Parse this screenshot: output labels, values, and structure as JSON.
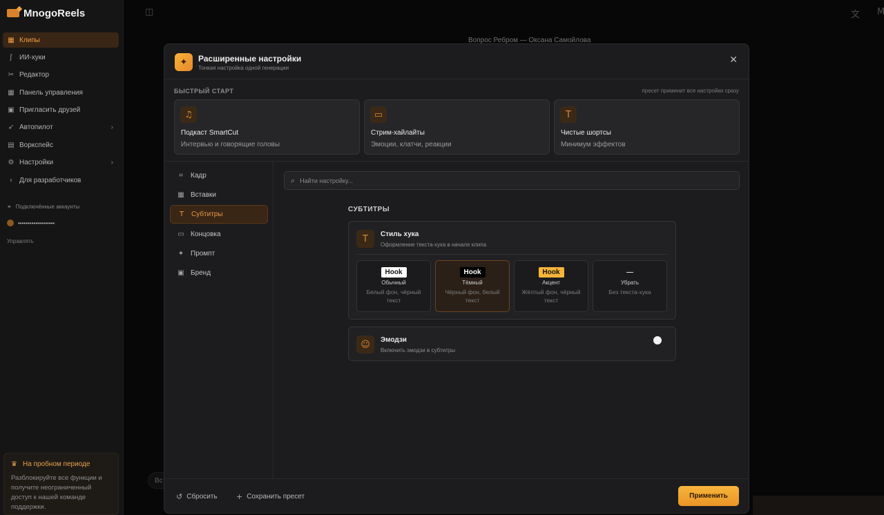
{
  "app": {
    "name": "MnogoReels"
  },
  "sidebar": {
    "items": [
      {
        "label": "Клипы",
        "icon": "clapper-icon",
        "glyph": "▦",
        "active": true
      },
      {
        "label": "ИИ-хуки",
        "icon": "hook-icon",
        "glyph": "ʃ"
      },
      {
        "label": "Редактор",
        "icon": "scissors-icon",
        "glyph": "✂"
      },
      {
        "label": "Панель управления",
        "icon": "grid-icon",
        "glyph": "▦"
      },
      {
        "label": "Пригласить друзей",
        "icon": "gift-icon",
        "glyph": "▣"
      },
      {
        "label": "Автопилот",
        "icon": "rocket-icon",
        "glyph": "➶",
        "chevron": true
      },
      {
        "label": "Воркспейс",
        "icon": "workspace-icon",
        "glyph": "▤"
      },
      {
        "label": "Настройки",
        "icon": "gear-icon",
        "glyph": "⚙",
        "chevron": true
      },
      {
        "label": "Для разработчиков",
        "icon": "terminal-icon",
        "glyph": "›"
      }
    ],
    "accounts_title": "Подключённые аккаунты",
    "account_name": "•••••••••••••••••••",
    "manage": "Управлять",
    "trial_title": "На пробном периоде",
    "trial_text": "Разблокируйте все функции и получите неограниченный доступ к нашей команде поддержки."
  },
  "background": {
    "video_title": "Вопрос Ребром — Оксана Самойлова",
    "pill": "Вс"
  },
  "modal": {
    "title": "Расширенные настройки",
    "subtitle": "Тонкая настройка одной генерации",
    "quick_start_label": "БЫСТРЫЙ СТАРТ",
    "quick_start_hint": "пресет применит все настройки сразу",
    "presets": [
      {
        "title": "Подкаст SmartCut",
        "desc": "Интервью и говорящие головы",
        "icon": "microphone-icon",
        "glyph": "♫"
      },
      {
        "title": "Стрим-хайлайты",
        "desc": "Эмоции, клатчи, реакции",
        "icon": "monitor-icon",
        "glyph": "▭"
      },
      {
        "title": "Чистые шортсы",
        "desc": "Минимум эффектов",
        "icon": "text-icon",
        "glyph": "T"
      }
    ],
    "nav": [
      {
        "label": "Кадр",
        "icon": "crop-icon",
        "glyph": "⌗"
      },
      {
        "label": "Вставки",
        "icon": "film-icon",
        "glyph": "▦"
      },
      {
        "label": "Субтитры",
        "icon": "text-icon",
        "glyph": "T",
        "active": true
      },
      {
        "label": "Концовка",
        "icon": "ending-icon",
        "glyph": "▭"
      },
      {
        "label": "Промпт",
        "icon": "sparkles-icon",
        "glyph": "✦"
      },
      {
        "label": "Бренд",
        "icon": "image-icon",
        "glyph": "▣"
      }
    ],
    "search_placeholder": "Найти настройку...",
    "section_title": "СУБТИТРЫ",
    "hook_style": {
      "title": "Стиль хука",
      "desc": "Оформление текста-хука в начале клипа",
      "options": [
        {
          "chip": "Hook",
          "name": "Обычный",
          "desc": "Белый фон, чёрный текст",
          "chip_bg": "#ffffff",
          "chip_fg": "#111111"
        },
        {
          "chip": "Hook",
          "name": "Тёмный",
          "desc": "Чёрный фон, белый текст",
          "chip_bg": "#000000",
          "chip_fg": "#ffffff",
          "selected": true
        },
        {
          "chip": "Hook",
          "name": "Акцент",
          "desc": "Жёлтый фон, чёрный текст",
          "chip_bg": "#f6b53a",
          "chip_fg": "#111111"
        },
        {
          "chip": "—",
          "name": "Убрать",
          "desc": "Без текста-хука",
          "chip_bg": "transparent",
          "chip_fg": "#e0e0e0"
        }
      ]
    },
    "emoji": {
      "title": "Эмодзи",
      "desc": "Включить эмодзи в субтитры",
      "enabled": false
    },
    "footer": {
      "reset": "Сбросить",
      "save_preset": "Сохранить пресет",
      "apply": "Применить"
    }
  },
  "colors": {
    "accent": "#f0a040",
    "background": "#0d0d0d",
    "modal": "#1c1c1e"
  }
}
